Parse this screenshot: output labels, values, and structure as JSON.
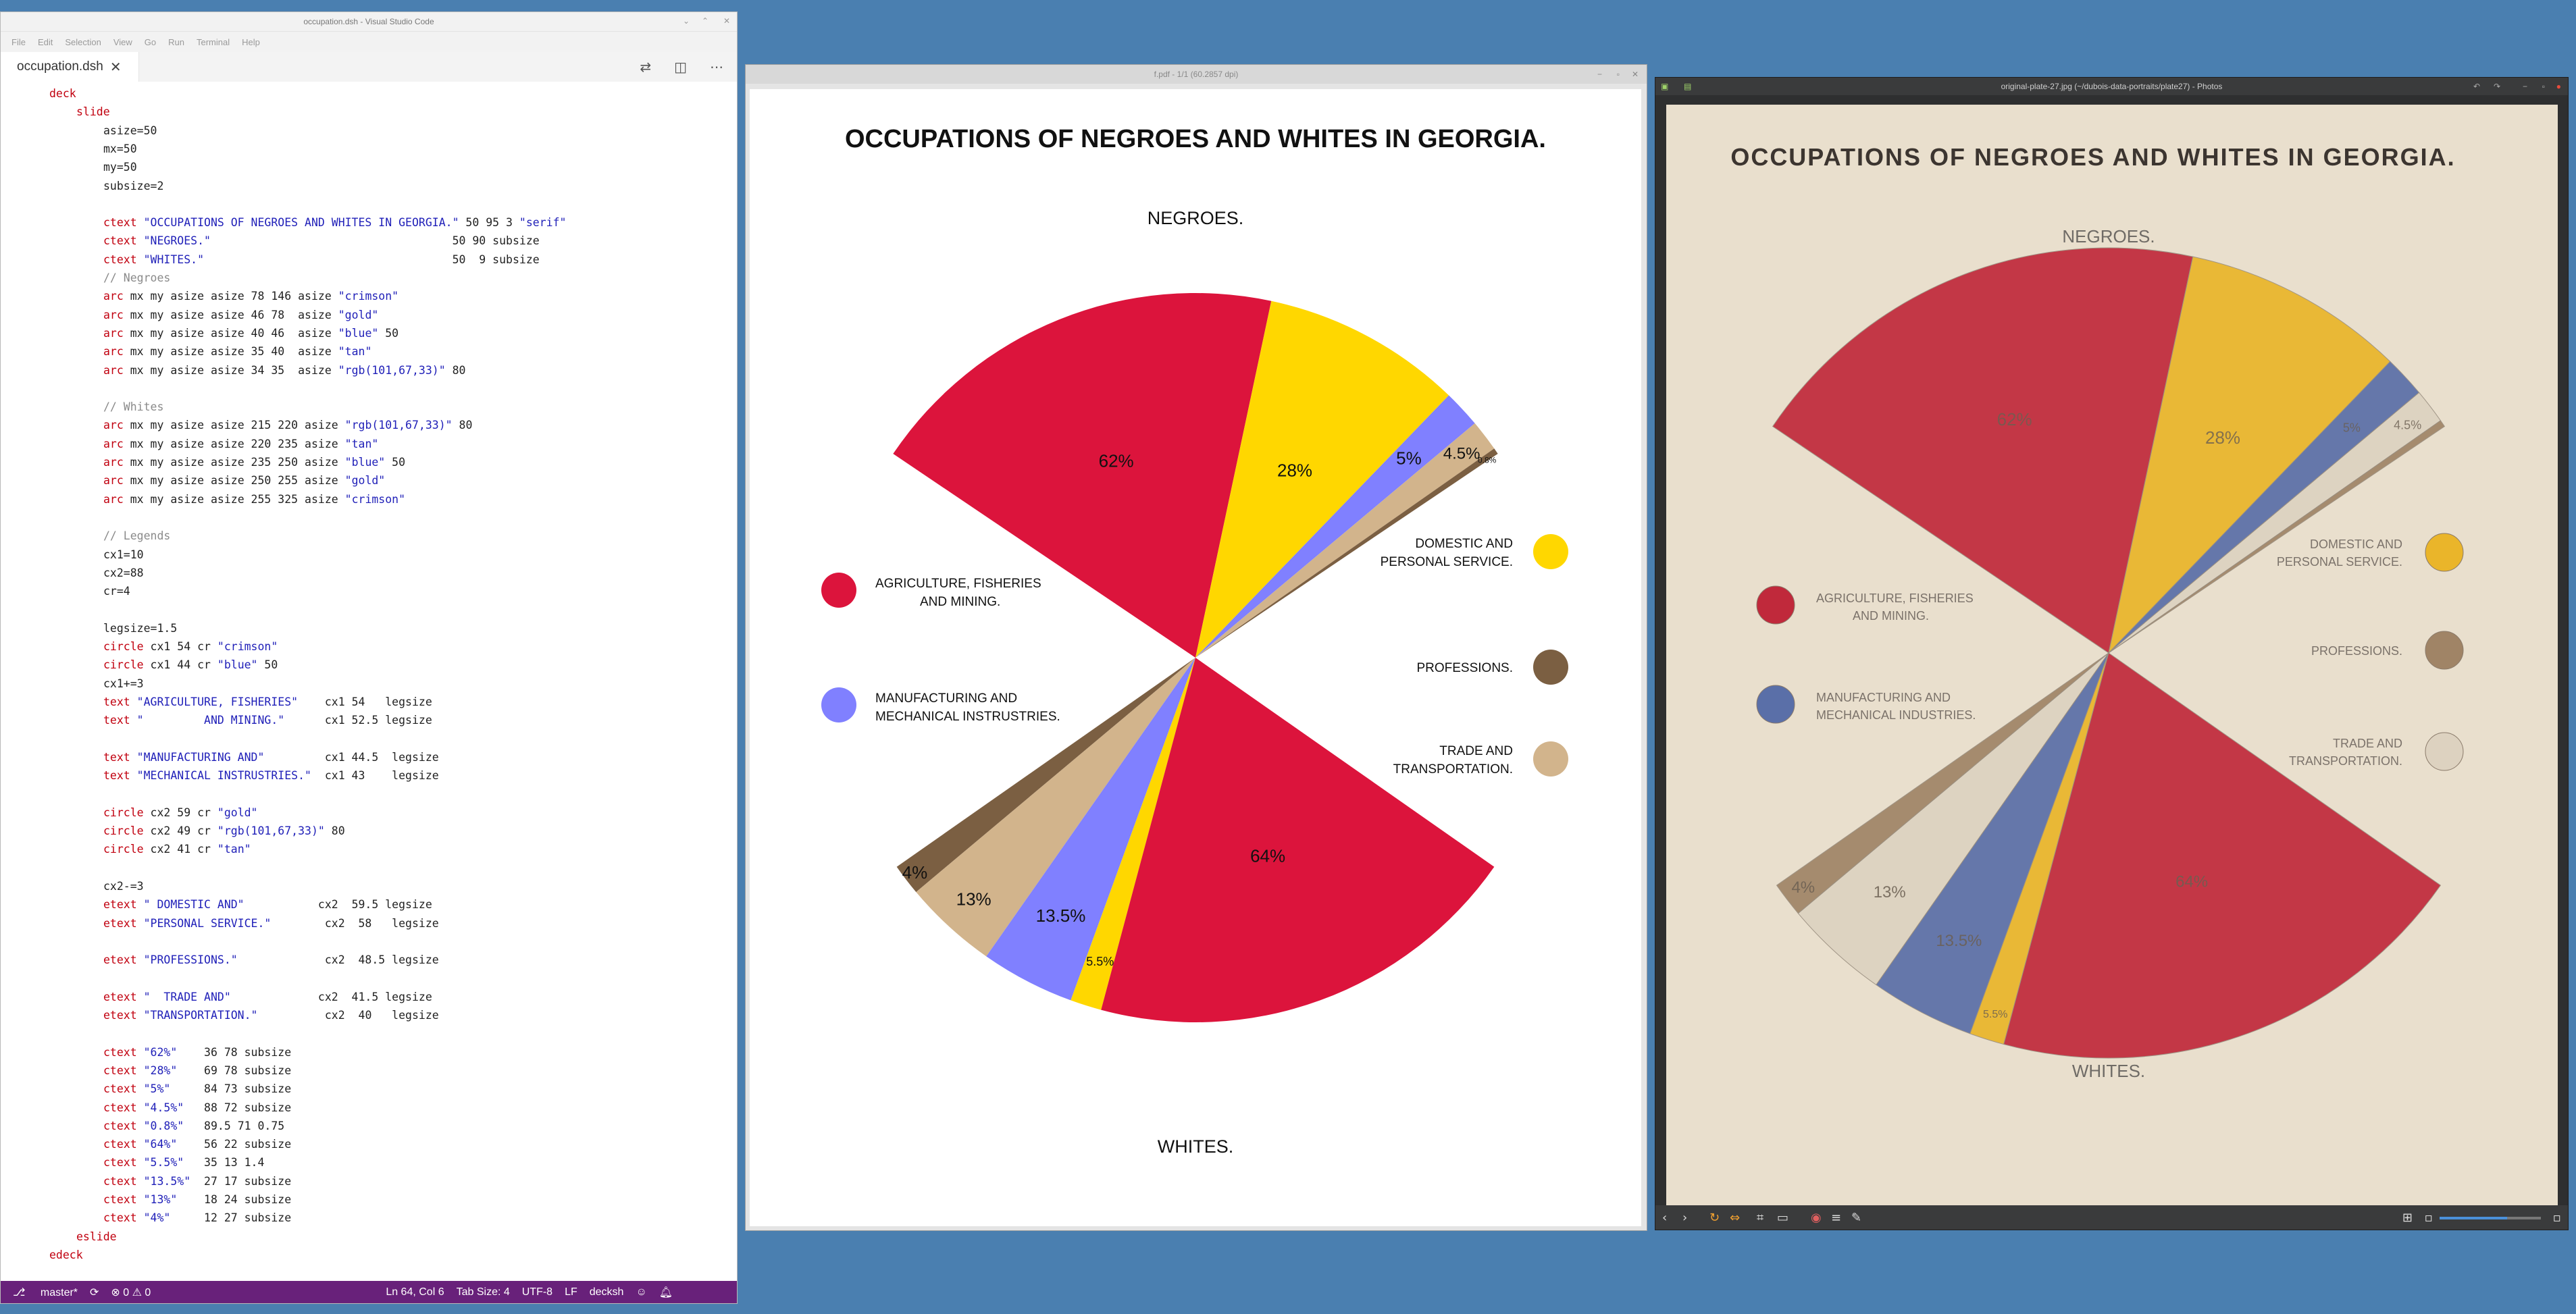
{
  "vscode": {
    "window_title": "occupation.dsh - Visual Studio Code",
    "menu": [
      "File",
      "Edit",
      "Selection",
      "View",
      "Go",
      "Run",
      "Terminal",
      "Help"
    ],
    "tab_label": "occupation.dsh",
    "tab_close_icon": "close-icon",
    "actions": [
      "open-changes-icon",
      "split-editor-icon",
      "more-actions-icon"
    ],
    "code": [
      {
        "indent": 0,
        "tokens": [
          [
            "kw",
            "deck"
          ]
        ]
      },
      {
        "indent": 1,
        "tokens": [
          [
            "kw",
            "slide"
          ]
        ]
      },
      {
        "indent": 2,
        "tokens": [
          [
            "plain",
            "asize=50"
          ]
        ]
      },
      {
        "indent": 2,
        "tokens": [
          [
            "plain",
            "mx=50"
          ]
        ]
      },
      {
        "indent": 2,
        "tokens": [
          [
            "plain",
            "my=50"
          ]
        ]
      },
      {
        "indent": 2,
        "tokens": [
          [
            "plain",
            "subsize=2"
          ]
        ]
      },
      {
        "indent": 2,
        "tokens": []
      },
      {
        "indent": 2,
        "tokens": [
          [
            "cmd",
            "ctext "
          ],
          [
            "str",
            "\"OCCUPATIONS OF NEGROES AND WHITES IN GEORGIA.\""
          ],
          [
            "plain",
            " 50 95 3 "
          ],
          [
            "str",
            "\"serif\""
          ]
        ]
      },
      {
        "indent": 2,
        "tokens": [
          [
            "cmd",
            "ctext "
          ],
          [
            "str",
            "\"NEGROES.\""
          ],
          [
            "plain",
            "                                    50 90 subsize"
          ]
        ]
      },
      {
        "indent": 2,
        "tokens": [
          [
            "cmd",
            "ctext "
          ],
          [
            "str",
            "\"WHITES.\""
          ],
          [
            "plain",
            "                                     50  9 subsize"
          ]
        ]
      },
      {
        "indent": 2,
        "tokens": [
          [
            "cmt",
            "// Negroes"
          ]
        ]
      },
      {
        "indent": 2,
        "tokens": [
          [
            "cmd",
            "arc "
          ],
          [
            "plain",
            "mx my asize asize 78 146 asize "
          ],
          [
            "str",
            "\"crimson\""
          ]
        ]
      },
      {
        "indent": 2,
        "tokens": [
          [
            "cmd",
            "arc "
          ],
          [
            "plain",
            "mx my asize asize 46 78  asize "
          ],
          [
            "str",
            "\"gold\""
          ]
        ]
      },
      {
        "indent": 2,
        "tokens": [
          [
            "cmd",
            "arc "
          ],
          [
            "plain",
            "mx my asize asize 40 46  asize "
          ],
          [
            "str",
            "\"blue\""
          ],
          [
            "plain",
            " 50"
          ]
        ]
      },
      {
        "indent": 2,
        "tokens": [
          [
            "cmd",
            "arc "
          ],
          [
            "plain",
            "mx my asize asize 35 40  asize "
          ],
          [
            "str",
            "\"tan\""
          ]
        ]
      },
      {
        "indent": 2,
        "tokens": [
          [
            "cmd",
            "arc "
          ],
          [
            "plain",
            "mx my asize asize 34 35  asize "
          ],
          [
            "str",
            "\"rgb(101,67,33)\""
          ],
          [
            "plain",
            " 80"
          ]
        ]
      },
      {
        "indent": 2,
        "tokens": []
      },
      {
        "indent": 2,
        "tokens": [
          [
            "cmt",
            "// Whites"
          ]
        ]
      },
      {
        "indent": 2,
        "tokens": [
          [
            "cmd",
            "arc "
          ],
          [
            "plain",
            "mx my asize asize 215 220 asize "
          ],
          [
            "str",
            "\"rgb(101,67,33)\""
          ],
          [
            "plain",
            " 80"
          ]
        ]
      },
      {
        "indent": 2,
        "tokens": [
          [
            "cmd",
            "arc "
          ],
          [
            "plain",
            "mx my asize asize 220 235 asize "
          ],
          [
            "str",
            "\"tan\""
          ]
        ]
      },
      {
        "indent": 2,
        "tokens": [
          [
            "cmd",
            "arc "
          ],
          [
            "plain",
            "mx my asize asize 235 250 asize "
          ],
          [
            "str",
            "\"blue\""
          ],
          [
            "plain",
            " 50"
          ]
        ]
      },
      {
        "indent": 2,
        "tokens": [
          [
            "cmd",
            "arc "
          ],
          [
            "plain",
            "mx my asize asize 250 255 asize "
          ],
          [
            "str",
            "\"gold\""
          ]
        ]
      },
      {
        "indent": 2,
        "tokens": [
          [
            "cmd",
            "arc "
          ],
          [
            "plain",
            "mx my asize asize 255 325 asize "
          ],
          [
            "str",
            "\"crimson\""
          ]
        ]
      },
      {
        "indent": 2,
        "tokens": []
      },
      {
        "indent": 2,
        "tokens": [
          [
            "cmt",
            "// Legends"
          ]
        ]
      },
      {
        "indent": 2,
        "tokens": [
          [
            "plain",
            "cx1=10"
          ]
        ]
      },
      {
        "indent": 2,
        "tokens": [
          [
            "plain",
            "cx2=88"
          ]
        ]
      },
      {
        "indent": 2,
        "tokens": [
          [
            "plain",
            "cr=4"
          ]
        ]
      },
      {
        "indent": 2,
        "tokens": []
      },
      {
        "indent": 2,
        "tokens": [
          [
            "plain",
            "legsize=1.5"
          ]
        ]
      },
      {
        "indent": 2,
        "tokens": [
          [
            "cmd",
            "circle "
          ],
          [
            "plain",
            "cx1 54 cr "
          ],
          [
            "str",
            "\"crimson\""
          ]
        ]
      },
      {
        "indent": 2,
        "tokens": [
          [
            "cmd",
            "circle "
          ],
          [
            "plain",
            "cx1 44 cr "
          ],
          [
            "str",
            "\"blue\""
          ],
          [
            "plain",
            " 50"
          ]
        ]
      },
      {
        "indent": 2,
        "tokens": [
          [
            "plain",
            "cx1+=3"
          ]
        ]
      },
      {
        "indent": 2,
        "tokens": [
          [
            "cmd",
            "text "
          ],
          [
            "str",
            "\"AGRICULTURE, FISHERIES\""
          ],
          [
            "plain",
            "    cx1 54   legsize"
          ]
        ]
      },
      {
        "indent": 2,
        "tokens": [
          [
            "cmd",
            "text "
          ],
          [
            "str",
            "\"         AND MINING.\""
          ],
          [
            "plain",
            "      cx1 52.5 legsize"
          ]
        ]
      },
      {
        "indent": 2,
        "tokens": []
      },
      {
        "indent": 2,
        "tokens": [
          [
            "cmd",
            "text "
          ],
          [
            "str",
            "\"MANUFACTURING AND\""
          ],
          [
            "plain",
            "         cx1 44.5  legsize"
          ]
        ]
      },
      {
        "indent": 2,
        "tokens": [
          [
            "cmd",
            "text "
          ],
          [
            "str",
            "\"MECHANICAL INSTRUSTRIES.\""
          ],
          [
            "plain",
            "  cx1 43    legsize"
          ]
        ]
      },
      {
        "indent": 2,
        "tokens": []
      },
      {
        "indent": 2,
        "tokens": [
          [
            "cmd",
            "circle "
          ],
          [
            "plain",
            "cx2 59 cr "
          ],
          [
            "str",
            "\"gold\""
          ]
        ]
      },
      {
        "indent": 2,
        "tokens": [
          [
            "cmd",
            "circle "
          ],
          [
            "plain",
            "cx2 49 cr "
          ],
          [
            "str",
            "\"rgb(101,67,33)\""
          ],
          [
            "plain",
            " 80"
          ]
        ]
      },
      {
        "indent": 2,
        "tokens": [
          [
            "cmd",
            "circle "
          ],
          [
            "plain",
            "cx2 41 cr "
          ],
          [
            "str",
            "\"tan\""
          ]
        ]
      },
      {
        "indent": 2,
        "tokens": []
      },
      {
        "indent": 2,
        "tokens": [
          [
            "plain",
            "cx2-=3"
          ]
        ]
      },
      {
        "indent": 2,
        "tokens": [
          [
            "cmd",
            "etext "
          ],
          [
            "str",
            "\" DOMESTIC AND\""
          ],
          [
            "plain",
            "           cx2  59.5 legsize"
          ]
        ]
      },
      {
        "indent": 2,
        "tokens": [
          [
            "cmd",
            "etext "
          ],
          [
            "str",
            "\"PERSONAL SERVICE.\""
          ],
          [
            "plain",
            "        cx2  58   legsize"
          ]
        ]
      },
      {
        "indent": 2,
        "tokens": []
      },
      {
        "indent": 2,
        "tokens": [
          [
            "cmd",
            "etext "
          ],
          [
            "str",
            "\"PROFESSIONS.\""
          ],
          [
            "plain",
            "             cx2  48.5 legsize"
          ]
        ]
      },
      {
        "indent": 2,
        "tokens": []
      },
      {
        "indent": 2,
        "tokens": [
          [
            "cmd",
            "etext "
          ],
          [
            "str",
            "\"  TRADE AND\""
          ],
          [
            "plain",
            "             cx2  41.5 legsize"
          ]
        ]
      },
      {
        "indent": 2,
        "tokens": [
          [
            "cmd",
            "etext "
          ],
          [
            "str",
            "\"TRANSPORTATION.\""
          ],
          [
            "plain",
            "          cx2  40   legsize"
          ]
        ]
      },
      {
        "indent": 2,
        "tokens": []
      },
      {
        "indent": 2,
        "tokens": [
          [
            "cmd",
            "ctext "
          ],
          [
            "str",
            "\"62%\""
          ],
          [
            "plain",
            "    36 78 subsize"
          ]
        ]
      },
      {
        "indent": 2,
        "tokens": [
          [
            "cmd",
            "ctext "
          ],
          [
            "str",
            "\"28%\""
          ],
          [
            "plain",
            "    69 78 subsize"
          ]
        ]
      },
      {
        "indent": 2,
        "tokens": [
          [
            "cmd",
            "ctext "
          ],
          [
            "str",
            "\"5%\""
          ],
          [
            "plain",
            "     84 73 subsize"
          ]
        ]
      },
      {
        "indent": 2,
        "tokens": [
          [
            "cmd",
            "ctext "
          ],
          [
            "str",
            "\"4.5%\""
          ],
          [
            "plain",
            "   88 72 subsize"
          ]
        ]
      },
      {
        "indent": 2,
        "tokens": [
          [
            "cmd",
            "ctext "
          ],
          [
            "str",
            "\"0.8%\""
          ],
          [
            "plain",
            "   89.5 71 0.75"
          ]
        ]
      },
      {
        "indent": 2,
        "tokens": [
          [
            "cmd",
            "ctext "
          ],
          [
            "str",
            "\"64%\""
          ],
          [
            "plain",
            "    56 22 subsize"
          ]
        ]
      },
      {
        "indent": 2,
        "tokens": [
          [
            "cmd",
            "ctext "
          ],
          [
            "str",
            "\"5.5%\""
          ],
          [
            "plain",
            "   35 13 1.4"
          ]
        ]
      },
      {
        "indent": 2,
        "tokens": [
          [
            "cmd",
            "ctext "
          ],
          [
            "str",
            "\"13.5%\""
          ],
          [
            "plain",
            "  27 17 subsize"
          ]
        ]
      },
      {
        "indent": 2,
        "tokens": [
          [
            "cmd",
            "ctext "
          ],
          [
            "str",
            "\"13%\""
          ],
          [
            "plain",
            "    18 24 subsize"
          ]
        ]
      },
      {
        "indent": 2,
        "tokens": [
          [
            "cmd",
            "ctext "
          ],
          [
            "str",
            "\"4%\""
          ],
          [
            "plain",
            "     12 27 subsize"
          ]
        ]
      },
      {
        "indent": 1,
        "tokens": [
          [
            "kw",
            "eslide"
          ]
        ]
      },
      {
        "indent": 0,
        "tokens": [
          [
            "kw",
            "edeck"
          ]
        ]
      }
    ],
    "status": {
      "branch": "master*",
      "sync_icon": "sync-icon",
      "problems": "⊗ 0 ⚠ 0",
      "position": "Ln 64, Col 6",
      "tab_size": "Tab Size: 4",
      "encoding": "UTF-8",
      "eol": "LF",
      "language": "decksh",
      "feedback_icon": "feedback-icon",
      "bell_icon": "bell-icon"
    }
  },
  "pdf": {
    "window_title": "f.pdf - 1/1 (60.2857 dpi)",
    "chart_title": "OCCUPATIONS OF NEGROES AND WHITES IN GEORGIA.",
    "top_label": "NEGROES.",
    "bottom_label": "WHITES.",
    "legend_left": [
      {
        "lines": [
          "AGRICULTURE, FISHERIES",
          "AND MINING."
        ],
        "color": "#dc143c"
      },
      {
        "lines": [
          "MANUFACTURING AND",
          "MECHANICAL INSTRUSTRIES."
        ],
        "color": "#8080ff"
      }
    ],
    "legend_right": [
      {
        "lines": [
          "DOMESTIC AND",
          "PERSONAL SERVICE."
        ],
        "color": "#ffd700"
      },
      {
        "lines": [
          "PROFESSIONS."
        ],
        "color": "#7b5f42"
      },
      {
        "lines": [
          "TRADE AND",
          "TRANSPORTATION."
        ],
        "color": "#d2b48c"
      }
    ]
  },
  "chart_data": {
    "type": "pie",
    "title": "OCCUPATIONS OF NEGROES AND WHITES IN GEORGIA.",
    "groups": [
      {
        "name": "NEGROES.",
        "slices": [
          {
            "category": "AGRICULTURE, FISHERIES AND MINING.",
            "start": 78,
            "end": 146,
            "color": "#dc143c",
            "label": "62%"
          },
          {
            "category": "DOMESTIC AND PERSONAL SERVICE.",
            "start": 46,
            "end": 78,
            "color": "#ffd700",
            "label": "28%"
          },
          {
            "category": "MANUFACTURING AND MECHANICAL INSTRUSTRIES.",
            "start": 40,
            "end": 46,
            "color": "#8080ff",
            "label": "5%"
          },
          {
            "category": "TRADE AND TRANSPORTATION.",
            "start": 35,
            "end": 40,
            "color": "#d2b48c",
            "label": "4.5%"
          },
          {
            "category": "PROFESSIONS.",
            "start": 34,
            "end": 35,
            "color": "#7b5f42",
            "label": "0.8%"
          }
        ]
      },
      {
        "name": "WHITES.",
        "slices": [
          {
            "category": "PROFESSIONS.",
            "start": 215,
            "end": 220,
            "color": "#7b5f42",
            "label": "4%"
          },
          {
            "category": "TRADE AND TRANSPORTATION.",
            "start": 220,
            "end": 235,
            "color": "#d2b48c",
            "label": "13%"
          },
          {
            "category": "MANUFACTURING AND MECHANICAL INSTRUSTRIES.",
            "start": 235,
            "end": 250,
            "color": "#8080ff",
            "label": "13.5%"
          },
          {
            "category": "DOMESTIC AND PERSONAL SERVICE.",
            "start": 250,
            "end": 255,
            "color": "#ffd700",
            "label": "5.5%"
          },
          {
            "category": "AGRICULTURE, FISHERIES AND MINING.",
            "start": 255,
            "end": 325,
            "color": "#dc143c",
            "label": "64%"
          }
        ]
      }
    ]
  },
  "photo": {
    "window_title": "original-plate-27.jpg (~/dubois-data-portraits/plate27) - Photos",
    "title": "OCCUPATIONS OF NEGROES AND WHITES IN GEORGIA.",
    "top_label": "NEGROES.",
    "bottom_label": "WHITES.",
    "legend_left": [
      {
        "lines": [
          "AGRICULTURE, FISHERIES",
          "AND MINING."
        ],
        "color": "#c0293b"
      },
      {
        "lines": [
          "MANUFACTURING AND",
          "MECHANICAL INDUSTRIES."
        ],
        "color": "#5a6fa8"
      }
    ],
    "legend_right": [
      {
        "lines": [
          "DOMESTIC AND",
          "PERSONAL SERVICE."
        ],
        "color": "#eab52a"
      },
      {
        "lines": [
          "PROFESSIONS."
        ],
        "color": "#a08466"
      },
      {
        "lines": [
          "TRADE AND",
          "TRANSPORTATION."
        ],
        "color": "#ddd2c0"
      }
    ],
    "labels_top": [
      "62%",
      "28%",
      "5%",
      "4.5%"
    ],
    "labels_bottom": [
      "4%",
      "13%",
      "13.5%",
      "5.5%",
      "64%"
    ],
    "colors": {
      "crimson": "#c0293b",
      "gold": "#eab52a",
      "blue": "#5a6fa8",
      "tan": "#ddd2c0",
      "brown": "#a08466"
    }
  }
}
